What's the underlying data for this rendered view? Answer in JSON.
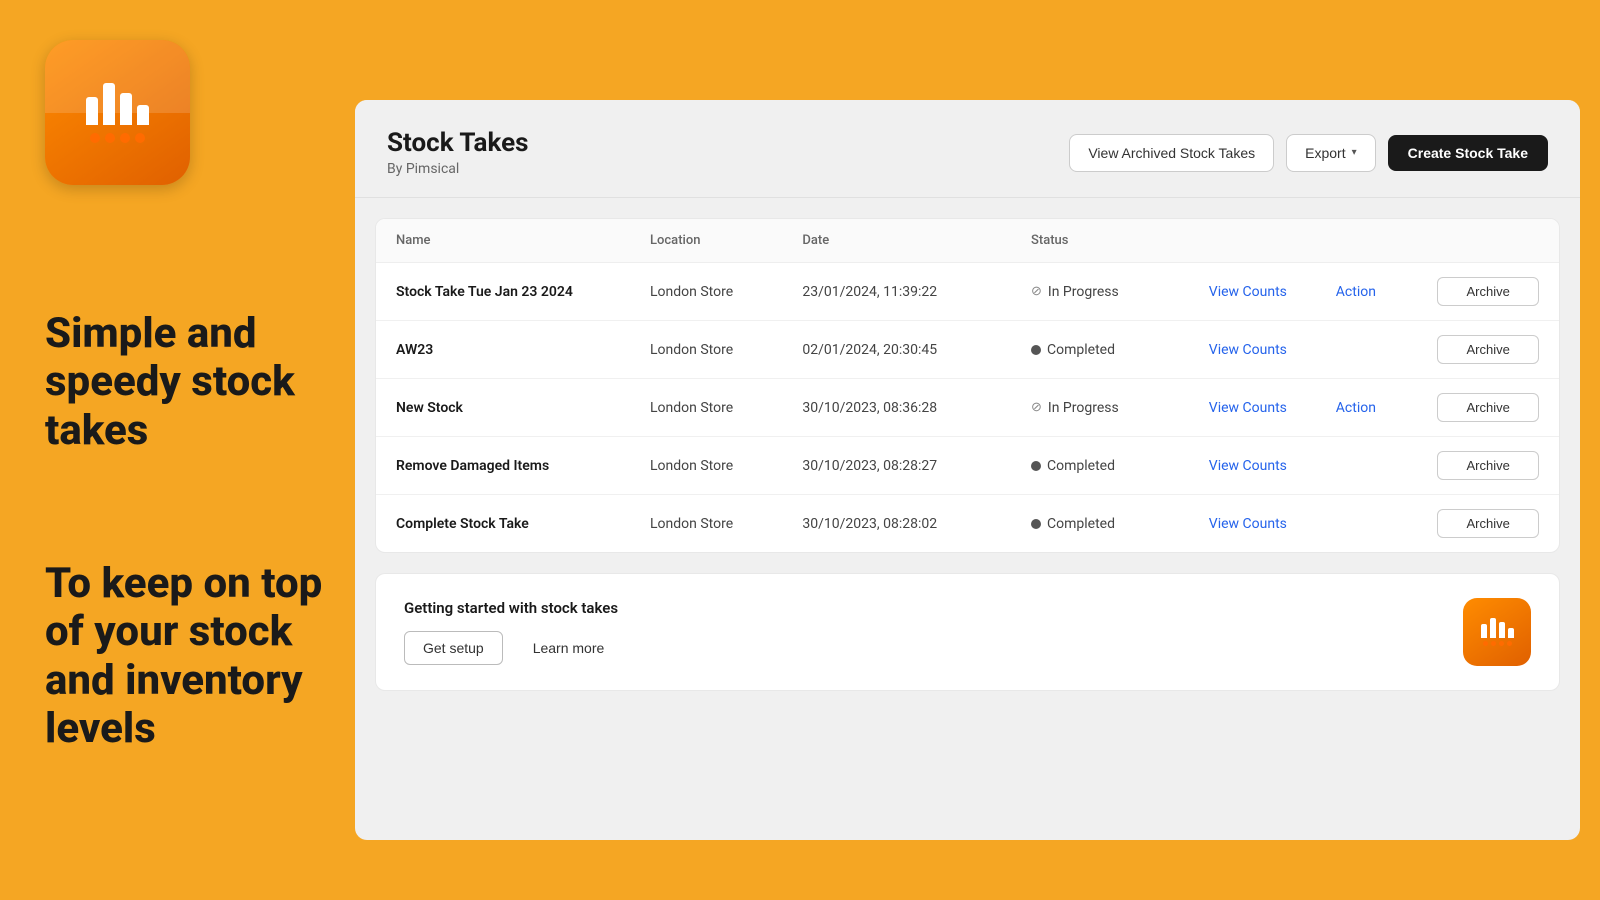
{
  "logo": {
    "alt": "Pimsical Logo"
  },
  "taglines": {
    "line1": "Simple and speedy stock takes",
    "line2": "To keep on top of your stock and inventory levels"
  },
  "header": {
    "title": "Stock Takes",
    "subtitle": "By Pimsical",
    "view_archived_label": "View Archived Stock Takes",
    "export_label": "Export",
    "create_label": "Create Stock Take"
  },
  "table": {
    "columns": [
      "Name",
      "Location",
      "Date",
      "Status",
      "",
      "",
      ""
    ],
    "rows": [
      {
        "name": "Stock Take Tue Jan 23 2024",
        "location": "London Store",
        "date": "23/01/2024, 11:39:22",
        "status": "In Progress",
        "status_type": "in-progress",
        "view_counts": "View Counts",
        "action": "Action",
        "archive": "Archive"
      },
      {
        "name": "AW23",
        "location": "London Store",
        "date": "02/01/2024, 20:30:45",
        "status": "Completed",
        "status_type": "completed",
        "view_counts": "View Counts",
        "action": "",
        "archive": "Archive"
      },
      {
        "name": "New Stock",
        "location": "London Store",
        "date": "30/10/2023, 08:36:28",
        "status": "In Progress",
        "status_type": "in-progress",
        "view_counts": "View Counts",
        "action": "Action",
        "archive": "Archive"
      },
      {
        "name": "Remove Damaged Items",
        "location": "London Store",
        "date": "30/10/2023, 08:28:27",
        "status": "Completed",
        "status_type": "completed",
        "view_counts": "View Counts",
        "action": "",
        "archive": "Archive"
      },
      {
        "name": "Complete Stock Take",
        "location": "London Store",
        "date": "30/10/2023, 08:28:02",
        "status": "Completed",
        "status_type": "completed",
        "view_counts": "View Counts",
        "action": "",
        "archive": "Archive"
      }
    ]
  },
  "getting_started": {
    "title": "Getting started with stock takes",
    "setup_label": "Get setup",
    "learn_label": "Learn more"
  }
}
